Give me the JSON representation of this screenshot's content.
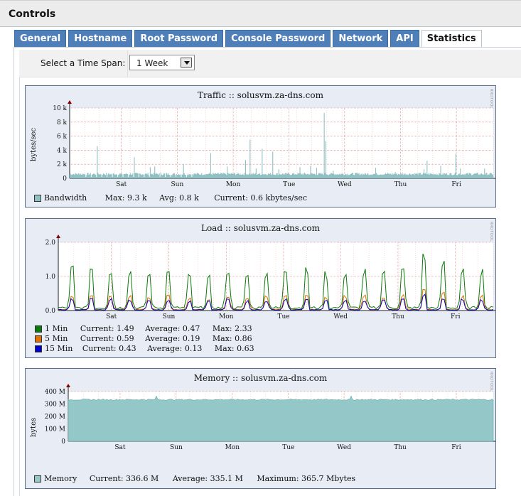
{
  "window": {
    "title": "Controls"
  },
  "tabs": [
    {
      "label": "General",
      "active": false
    },
    {
      "label": "Hostname",
      "active": false
    },
    {
      "label": "Root Password",
      "active": false
    },
    {
      "label": "Console Password",
      "active": false
    },
    {
      "label": "Network",
      "active": false
    },
    {
      "label": "API",
      "active": false
    },
    {
      "label": "Statistics",
      "active": true
    }
  ],
  "timespan": {
    "label": "Select a Time Span:",
    "selected": "1 Week"
  },
  "watermark": "RRDTOOL / TOBI OETIKER",
  "colors": {
    "tab_bg": "#4f7fb8",
    "graph_bg": "#e7ecf5",
    "traffic_fill": "#8fc0c4",
    "load_1": "#0a7a0a",
    "load_5": "#e07000",
    "load_15": "#0000cc",
    "memory_fill": "#93c7c8"
  },
  "graphs": {
    "traffic": {
      "title": "Traffic :: solusvm.za-dns.com",
      "ylabel": "bytes/sec",
      "legend": {
        "name": "Bandwidth",
        "max": "Max:  9.3 k",
        "avg": "Avg:  0.8 k",
        "current": "Current:  0.6 kbytes/sec"
      }
    },
    "load": {
      "title": "Load :: solusvm.za-dns.com",
      "legend": [
        {
          "name": "1 Min",
          "current": "Current:  1.49",
          "average": "Average:  0.47",
          "max": "Max:  2.33"
        },
        {
          "name": "5 Min",
          "current": "Current:  0.59",
          "average": "Average:  0.19",
          "max": "Max:  0.86"
        },
        {
          "name": "15 Min",
          "current": "Current:  0.43",
          "average": "Average:  0.13",
          "max": "Max:  0.63"
        }
      ]
    },
    "memory": {
      "title": "Memory :: solusvm.za-dns.com",
      "ylabel": "bytes",
      "legend": {
        "name": "Memory",
        "current": "Current: 336.6 M",
        "average": "Average: 335.1 M",
        "maximum": "Maximum: 365.7 Mbytes"
      }
    }
  },
  "chart_data": [
    {
      "type": "area",
      "title": "Traffic :: solusvm.za-dns.com",
      "ylabel": "bytes/sec",
      "categories": [
        "Sat",
        "Sun",
        "Mon",
        "Tue",
        "Wed",
        "Thu",
        "Fri"
      ],
      "yticks": [
        "0",
        "2 k",
        "4 k",
        "6 k",
        "8 k",
        "10 k"
      ],
      "ylim": [
        0,
        10000
      ],
      "series": [
        {
          "name": "Bandwidth",
          "max": 9300,
          "avg": 800,
          "current": 600
        }
      ]
    },
    {
      "type": "line",
      "title": "Load :: solusvm.za-dns.com",
      "categories": [
        "Sat",
        "Sun",
        "Mon",
        "Tue",
        "Wed",
        "Thu",
        "Fri"
      ],
      "yticks": [
        "0.0",
        "1.0",
        "2.0"
      ],
      "ylim": [
        0,
        2.5
      ],
      "series": [
        {
          "name": "1 Min",
          "current": 1.49,
          "average": 0.47,
          "max": 2.33
        },
        {
          "name": "5 Min",
          "current": 0.59,
          "average": 0.19,
          "max": 0.86
        },
        {
          "name": "15 Min",
          "current": 0.43,
          "average": 0.13,
          "max": 0.63
        }
      ]
    },
    {
      "type": "area",
      "title": "Memory :: solusvm.za-dns.com",
      "ylabel": "bytes",
      "categories": [
        "Sat",
        "Sun",
        "Mon",
        "Tue",
        "Wed",
        "Thu",
        "Fri"
      ],
      "yticks": [
        "0",
        "100 M",
        "200 M",
        "300 M",
        "400 M"
      ],
      "ylim": [
        0,
        400
      ],
      "series": [
        {
          "name": "Memory",
          "current": 336.6,
          "average": 335.1,
          "max": 365.7
        }
      ]
    }
  ]
}
